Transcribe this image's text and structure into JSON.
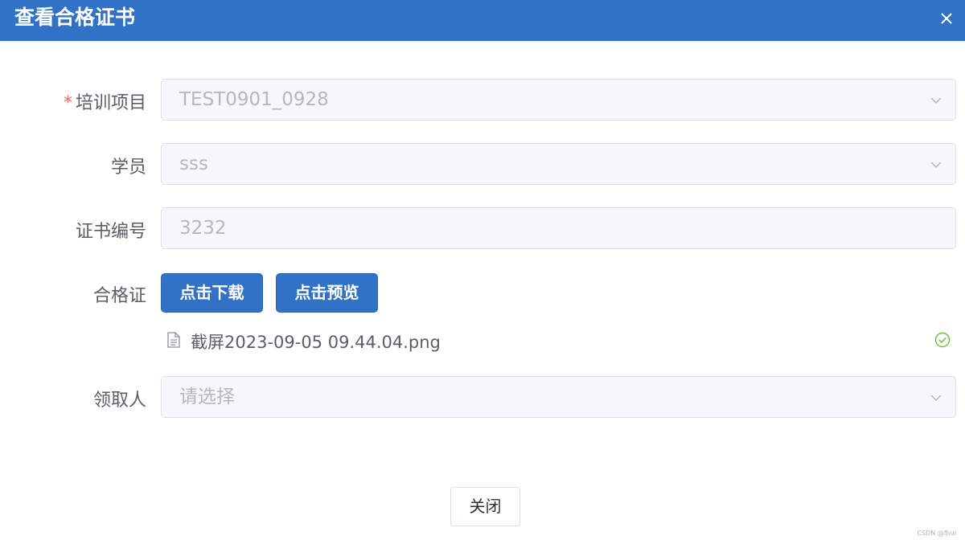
{
  "dialog": {
    "title": "查看合格证书"
  },
  "form": {
    "project": {
      "label": "培训项目",
      "required_mark": "*",
      "value": "TEST0901_0928"
    },
    "student": {
      "label": "学员",
      "value": "sss"
    },
    "cert_no": {
      "label": "证书编号",
      "value": "3232"
    },
    "certificate": {
      "label": "合格证",
      "download_label": "点击下载",
      "preview_label": "点击预览",
      "file_name": "截屏2023-09-05 09.44.04.png"
    },
    "receiver": {
      "label": "领取人",
      "placeholder": "请选择"
    }
  },
  "footer": {
    "close_label": "关闭"
  },
  "watermark": "CSDN @fhur",
  "colors": {
    "header": "#3272c6",
    "primary": "#3272c6",
    "required": "#f56c6c",
    "success": "#67c23a"
  },
  "icons": [
    "close-icon",
    "chevron-down-icon",
    "document-icon",
    "check-circle-icon"
  ]
}
